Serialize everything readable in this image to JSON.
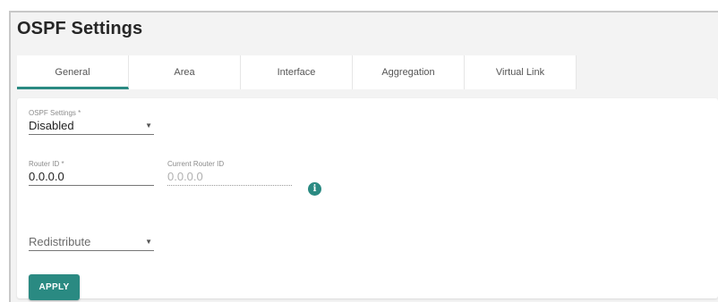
{
  "page": {
    "title": "OSPF Settings"
  },
  "tabs": [
    {
      "label": "General",
      "active": true
    },
    {
      "label": "Area",
      "active": false
    },
    {
      "label": "Interface",
      "active": false
    },
    {
      "label": "Aggregation",
      "active": false
    },
    {
      "label": "Virtual Link",
      "active": false
    }
  ],
  "form": {
    "ospf_settings": {
      "label": "OSPF Settings *",
      "value": "Disabled"
    },
    "router_id": {
      "label": "Router ID *",
      "value": "0.0.0.0"
    },
    "current_router_id": {
      "label": "Current Router ID",
      "value": "0.0.0.0"
    },
    "info_icon_glyph": "i",
    "redistribute": {
      "placeholder": "Redistribute"
    },
    "apply_label": "APPLY"
  },
  "icons": {
    "caret": "chevron-down-icon",
    "info": "info-icon"
  },
  "colors": {
    "accent": "#2a8a82",
    "background": "#f3f3f3"
  }
}
